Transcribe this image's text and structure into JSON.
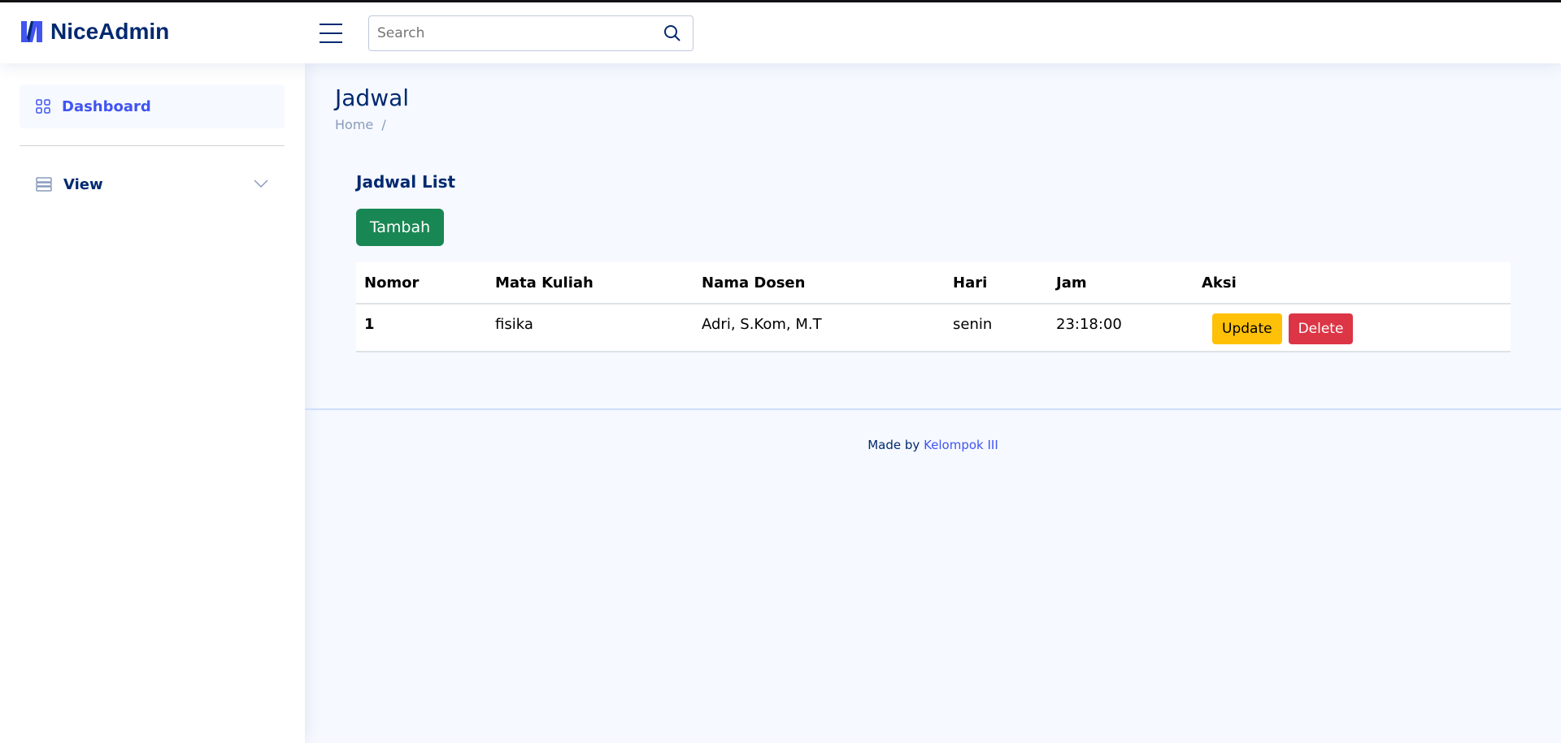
{
  "header": {
    "logo": "NiceAdmin",
    "search_placeholder": "Search"
  },
  "sidebar": {
    "items": [
      {
        "label": "Dashboard",
        "icon": "grid-icon"
      },
      {
        "label": "View",
        "icon": "layout-icon"
      }
    ]
  },
  "page": {
    "title": "Jadwal",
    "breadcrumb": [
      "Home",
      "/"
    ]
  },
  "card": {
    "title": "Jadwal List",
    "add_label": "Tambah"
  },
  "table": {
    "headers": [
      "Nomor",
      "Mata Kuliah",
      "Nama Dosen",
      "Hari",
      "Jam",
      "Aksi"
    ],
    "rows": [
      {
        "nomor": "1",
        "mata_kuliah": "fisika",
        "nama_dosen": "Adri, S.Kom, M.T",
        "hari": "senin",
        "jam": "23:18:00",
        "update": "Update",
        "delete": "Delete"
      }
    ]
  },
  "footer": {
    "text": "Made by",
    "link": "Kelompok III"
  },
  "colors": {
    "primary": "#4154f1",
    "navy": "#012970",
    "success": "#198754",
    "warning": "#ffc107",
    "danger": "#dc3545"
  }
}
